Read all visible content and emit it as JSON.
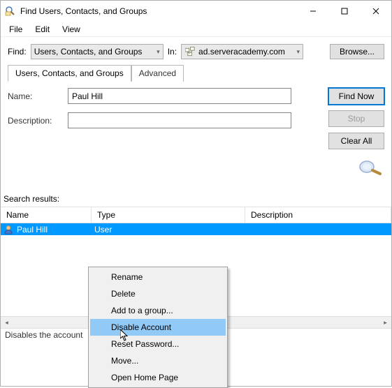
{
  "window": {
    "title": "Find Users, Contacts, and Groups"
  },
  "menu": {
    "file": "File",
    "edit": "Edit",
    "view": "View"
  },
  "find": {
    "label": "Find:",
    "combo_value": "Users, Contacts, and Groups",
    "in_label": "In:",
    "in_value": "ad.serveracademy.com",
    "browse": "Browse..."
  },
  "tabs": {
    "main": "Users, Contacts, and Groups",
    "adv": "Advanced"
  },
  "form": {
    "name_label": "Name:",
    "name_value": "Paul Hill",
    "desc_label": "Description:",
    "desc_value": ""
  },
  "buttons": {
    "findnow": "Find Now",
    "stop": "Stop",
    "clearall": "Clear All"
  },
  "results": {
    "label": "Search results:",
    "headers": {
      "name": "Name",
      "type": "Type",
      "desc": "Description"
    },
    "rows": [
      {
        "name": "Paul Hill",
        "type": "User",
        "desc": ""
      }
    ]
  },
  "context": {
    "rename": "Rename",
    "delete": "Delete",
    "addgroup": "Add to a group...",
    "disable": "Disable Account",
    "resetpw": "Reset Password...",
    "move": "Move...",
    "openhome": "Open Home Page"
  },
  "status": "Disables the account"
}
